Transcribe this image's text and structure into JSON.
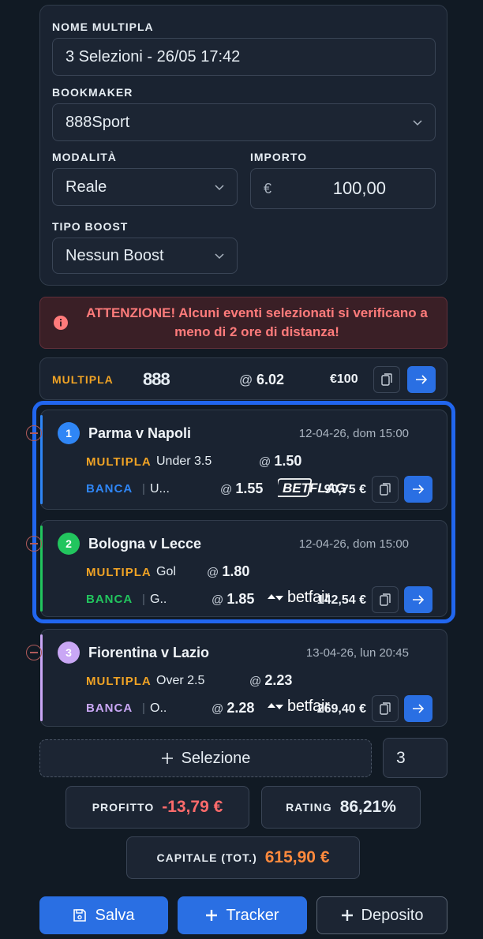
{
  "form": {
    "name_label": "NOME MULTIPLA",
    "name_value": "3 Selezioni - 26/05 17:42",
    "bookmaker_label": "BOOKMAKER",
    "bookmaker_value": "888Sport",
    "mode_label": "MODALITÀ",
    "mode_value": "Reale",
    "amount_label": "IMPORTO",
    "currency_symbol": "€",
    "amount_value": "100,00",
    "boost_label": "TIPO BOOST",
    "boost_value": "Nessun Boost"
  },
  "alert": {
    "text": "ATTENZIONE! Alcuni eventi selezionati si verificano a meno di 2 ore di distanza!"
  },
  "summary": {
    "type": "MULTIPLA",
    "bookmaker_logo": "888",
    "odds_prefix": "@",
    "odds": "6.02",
    "stake": "€100"
  },
  "selections": [
    {
      "number": "1",
      "match": "Parma v Napoli",
      "date": "12-04-26, dom 15:00",
      "multi_label": "MULTIPLA",
      "market": "Under 3.5",
      "odds": "1.50",
      "lay_label": "BANCA",
      "lay_market": "U...",
      "lay_odds": "1.55",
      "exchange": "BETFLAG",
      "lay_amount": "90,75 €",
      "accent": "#2f86f6"
    },
    {
      "number": "2",
      "match": "Bologna v Lecce",
      "date": "12-04-26, dom 15:00",
      "multi_label": "MULTIPLA",
      "market": "Gol",
      "odds": "1.80",
      "lay_label": "BANCA",
      "lay_market": "G..",
      "lay_odds": "1.85",
      "exchange": "betfair",
      "lay_amount": "142,54 €",
      "accent": "#22c55e"
    },
    {
      "number": "3",
      "match": "Fiorentina v Lazio",
      "date": "13-04-26, lun 20:45",
      "multi_label": "MULTIPLA",
      "market": "Over 2.5",
      "odds": "2.23",
      "lay_label": "BANCA",
      "lay_market": "O..",
      "lay_odds": "2.28",
      "exchange": "betfair",
      "lay_amount": "269,40 €",
      "accent": "#c9a7f5"
    }
  ],
  "add_selection": {
    "label": "Selezione",
    "count": "3"
  },
  "stats": {
    "profit_label": "PROFITTO",
    "profit_value": "-13,79 €",
    "rating_label": "RATING",
    "rating_value": "86,21%",
    "capital_label": "CAPITALE (TOT.)",
    "capital_value": "615,90 €"
  },
  "actions": {
    "save": "Salva",
    "tracker": "Tracker",
    "deposit": "Deposito"
  },
  "colors": {
    "accent_blue": "#2a6fe3",
    "multi_orange": "#f0a325",
    "profit_red": "#ff6b6b",
    "capital_orange": "#ff8a3d"
  },
  "icons": {
    "info": "info-icon",
    "chevron": "chevron-down-icon",
    "copy": "copy-icon",
    "arrow": "arrow-right-icon",
    "plus": "plus-icon",
    "save": "save-icon"
  }
}
